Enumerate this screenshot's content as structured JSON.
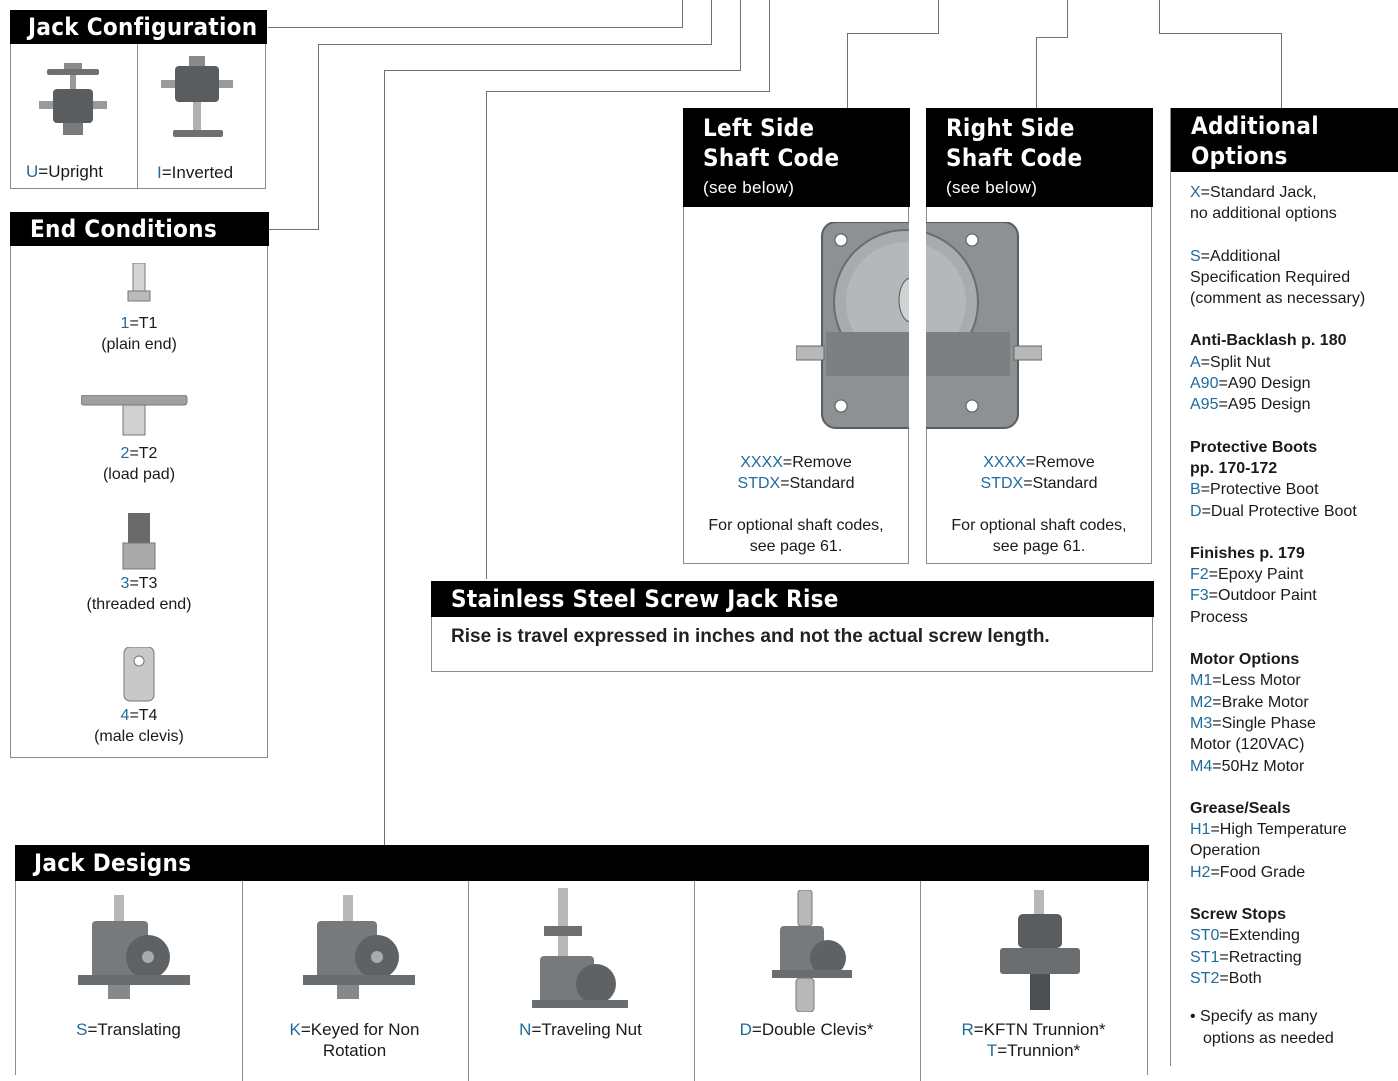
{
  "jack_configuration": {
    "title": "Jack Configuration",
    "options": [
      {
        "code": "U",
        "label": "=Upright"
      },
      {
        "code": "I",
        "label": "=Inverted"
      }
    ]
  },
  "end_conditions": {
    "title": "End Conditions",
    "items": [
      {
        "code": "1",
        "label": "=T1",
        "desc": "(plain end)"
      },
      {
        "code": "2",
        "label": "=T2",
        "desc": "(load pad)"
      },
      {
        "code": "3",
        "label": "=T3",
        "desc": "(threaded end)"
      },
      {
        "code": "4",
        "label": "=T4",
        "desc": "(male clevis)"
      }
    ]
  },
  "left_shaft": {
    "title_line1": "Left Side",
    "title_line2": "Shaft Code",
    "subtitle": "(see below)",
    "opt1_code": "XXXX",
    "opt1_label": "=Remove",
    "opt2_code": "STDX",
    "opt2_label": "=Standard",
    "note_line1": "For optional shaft codes,",
    "note_line2": "see page 61."
  },
  "right_shaft": {
    "title_line1": "Right Side",
    "title_line2": "Shaft Code",
    "subtitle": "(see below)",
    "opt1_code": "XXXX",
    "opt1_label": "=Remove",
    "opt2_code": "STDX",
    "opt2_label": "=Standard",
    "note_line1": "For optional shaft codes,",
    "note_line2": "see page 61."
  },
  "rise": {
    "title": "Stainless Steel Screw Jack Rise",
    "text": "Rise is travel expressed in inches and not the actual screw length."
  },
  "additional": {
    "title_line1": "Additional",
    "title_line2": "Options",
    "standard": {
      "code": "X",
      "line1": "=Standard Jack,",
      "line2": "no additional options"
    },
    "special": {
      "code": "S",
      "line1": "=Additional",
      "line2": "Specification Required",
      "line3": "(comment as necessary)"
    },
    "anti_backlash": {
      "heading": "Anti-Backlash p. 180",
      "items": [
        {
          "code": "A",
          "label": "=Split Nut"
        },
        {
          "code": "A90",
          "label": "=A90 Design"
        },
        {
          "code": "A95",
          "label": "=A95 Design"
        }
      ]
    },
    "boots": {
      "heading1": "Protective Boots",
      "heading2": "pp. 170-172",
      "items": [
        {
          "code": "B",
          "label": "=Protective Boot"
        },
        {
          "code": "D",
          "label": "=Dual Protective Boot"
        }
      ]
    },
    "finishes": {
      "heading": "Finishes p. 179",
      "items": [
        {
          "code": "F2",
          "label": "=Epoxy Paint"
        },
        {
          "code": "F3",
          "label": "=Outdoor Paint"
        }
      ],
      "extra": "Process"
    },
    "motor": {
      "heading": "Motor Options",
      "m1_code": "M1",
      "m1_label": "=Less Motor",
      "m2_code": "M2",
      "m2_label": "=Brake Motor",
      "m3_code": "M3",
      "m3_label": "=Single Phase",
      "m3_line2": "Motor (120VAC)",
      "m4_code": "M4",
      "m4_label": "=50Hz Motor"
    },
    "grease": {
      "heading": "Grease/Seals",
      "h1_code": "H1",
      "h1_label": "=High Temperature",
      "h1_line2": "Operation",
      "h2_code": "H2",
      "h2_label": "=Food Grade"
    },
    "stops": {
      "heading": "Screw Stops",
      "items": [
        {
          "code": "ST0",
          "label": "=Extending"
        },
        {
          "code": "ST1",
          "label": "=Retracting"
        },
        {
          "code": "ST2",
          "label": "=Both"
        }
      ]
    },
    "bullet_line1": "• Specify as many",
    "bullet_line2": "options as needed"
  },
  "jack_designs": {
    "title": "Jack Designs",
    "items": [
      {
        "code": "S",
        "label": "=Translating",
        "line2": ""
      },
      {
        "code": "K",
        "label": "=Keyed for Non",
        "line2": "Rotation"
      },
      {
        "code": "N",
        "label": "=Traveling Nut",
        "line2": ""
      },
      {
        "code": "D",
        "label": "=Double Clevis*",
        "line2": ""
      },
      {
        "code": "R",
        "label": "=KFTN Trunnion*",
        "code2": "T",
        "line2": "=Trunnion*"
      }
    ]
  },
  "colors": {
    "accent": "#1f6b9e",
    "header_bg": "#000000",
    "border": "#8c8c8c"
  }
}
